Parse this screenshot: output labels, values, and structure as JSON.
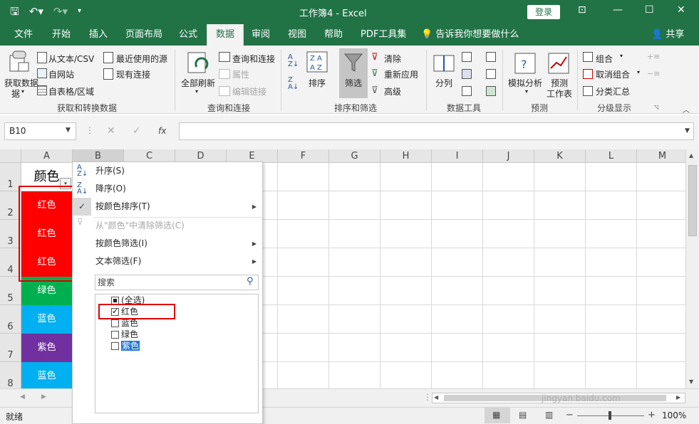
{
  "titlebar": {
    "title": "工作簿4 - Excel",
    "login": "登录"
  },
  "tabs": [
    "文件",
    "开始",
    "插入",
    "页面布局",
    "公式",
    "数据",
    "审阅",
    "视图",
    "帮助",
    "PDF工具集"
  ],
  "tell_me": "告诉我你想要做什么",
  "share": "共享",
  "ribbon": {
    "get_data": "获取数据",
    "get_data2": "据",
    "from_text": "从文本/CSV",
    "from_web": "自网站",
    "from_table": "自表格/区域",
    "recent_sources": "最近使用的源",
    "existing_conn": "现有连接",
    "group1": "获取和转换数据",
    "refresh_all": "全部刷新",
    "queries_conn": "查询和连接",
    "properties": "属性",
    "edit_links": "编辑链接",
    "group2": "查询和连接",
    "sort": "排序",
    "filter": "筛选",
    "clear": "清除",
    "reapply": "重新应用",
    "advanced": "高级",
    "group3": "排序和筛选",
    "text_to_columns": "分列",
    "group4": "数据工具",
    "what_if": "模拟分析",
    "forecast_sheet": "预测",
    "forecast_sheet2": "工作表",
    "group5": "预测",
    "group_cmd": "组合",
    "ungroup": "取消组合",
    "subtotal": "分类汇总",
    "group6": "分级显示"
  },
  "formula_bar": {
    "name_box": "B10",
    "fx": "fx",
    "value": ""
  },
  "columns": [
    "A",
    "B",
    "C",
    "D",
    "E",
    "F",
    "G",
    "H",
    "I",
    "J",
    "K",
    "L",
    "M"
  ],
  "rows": [
    "1",
    "2",
    "3",
    "4",
    "5",
    "6",
    "7",
    "8"
  ],
  "cells": {
    "header": "颜色",
    "colors": [
      {
        "text": "红色",
        "fill": "#ff0000"
      },
      {
        "text": "红色",
        "fill": "#ff0000"
      },
      {
        "text": "红色",
        "fill": "#ff0000"
      },
      {
        "text": "绿色",
        "fill": "#00b050"
      },
      {
        "text": "蓝色",
        "fill": "#00b0f0"
      },
      {
        "text": "紫色",
        "fill": "#7030a0"
      },
      {
        "text": "蓝色",
        "fill": "#00b0f0"
      }
    ]
  },
  "filter_menu": {
    "sort_asc": "升序(S)",
    "sort_desc": "降序(O)",
    "sort_by_color": "按颜色排序(T)",
    "clear_filter": "从\"颜色\"中清除筛选(C)",
    "filter_by_color": "按颜色筛选(I)",
    "text_filter": "文本筛选(F)",
    "search_placeholder": "搜索",
    "items": [
      {
        "label": "(全选)",
        "state": "partial"
      },
      {
        "label": "红色",
        "state": "checked"
      },
      {
        "label": "蓝色",
        "state": "unchecked"
      },
      {
        "label": "绿色",
        "state": "unchecked"
      },
      {
        "label": "紫色",
        "state": "unchecked"
      }
    ]
  },
  "status": {
    "ready": "就绪",
    "zoom": "100%"
  },
  "watermark": "jingyan.baidu.com"
}
